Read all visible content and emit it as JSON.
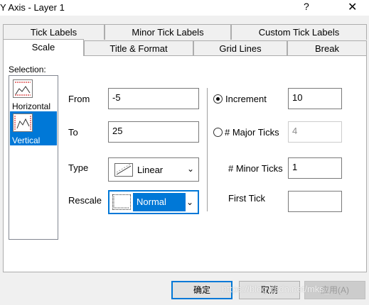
{
  "window": {
    "title": "Y Axis - Layer 1",
    "help": "?",
    "close": "✕"
  },
  "tabs": {
    "row_back": [
      "Tick Labels",
      "Minor Tick Labels",
      "Custom Tick Labels"
    ],
    "row_front": [
      "Scale",
      "Title & Format",
      "Grid Lines",
      "Break"
    ],
    "active": "Scale"
  },
  "selection": {
    "label": "Selection:",
    "items": [
      {
        "label": "Horizontal",
        "icon": "horizontal-axis-icon",
        "selected": false
      },
      {
        "label": "Vertical",
        "icon": "vertical-axis-icon",
        "selected": true
      }
    ]
  },
  "scale": {
    "from_label": "From",
    "from_value": "-5",
    "to_label": "To",
    "to_value": "25",
    "type_label": "Type",
    "type_value": "Linear",
    "rescale_label": "Rescale",
    "rescale_value": "Normal"
  },
  "ticks": {
    "increment_label": "Increment",
    "increment_value": "10",
    "increment_checked": true,
    "major_label": "# Major Ticks",
    "major_value": "4",
    "major_checked": false,
    "minor_label": "# Minor Ticks",
    "minor_value": "1",
    "first_label": "First Tick",
    "first_value": ""
  },
  "buttons": {
    "ok": "确定",
    "cancel": "取消",
    "apply": "应用(A)"
  },
  "watermark": "https://blog.csdn.net/mks_",
  "colors": {
    "accent": "#0078d7",
    "panel": "#ffffff",
    "dialog": "#f0f0f0"
  }
}
